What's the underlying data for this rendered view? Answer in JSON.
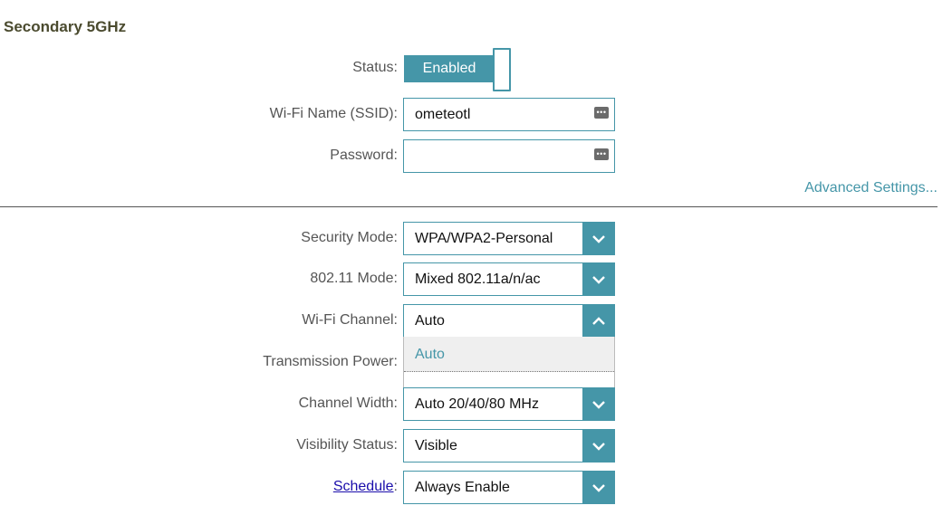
{
  "section_title": "Secondary 5GHz",
  "status": {
    "label": "Status:",
    "toggle_text": "Enabled"
  },
  "ssid": {
    "label": "Wi-Fi Name (SSID):",
    "value": "ometeotl",
    "icon": "keyboard-icon"
  },
  "password": {
    "label": "Password:",
    "value": "",
    "icon": "keyboard-icon"
  },
  "advanced_link": "Advanced Settings...",
  "security_mode": {
    "label": "Security Mode:",
    "value": "WPA/WPA2-Personal"
  },
  "mode_80211": {
    "label": "802.11 Mode:",
    "value": "Mixed 802.11a/n/ac"
  },
  "wifi_channel": {
    "label": "Wi-Fi Channel:",
    "value": "Auto",
    "options": [
      "Auto"
    ]
  },
  "transmission_power": {
    "label": "Transmission Power:"
  },
  "channel_width": {
    "label": "Channel Width:",
    "value": "Auto 20/40/80 MHz"
  },
  "visibility_status": {
    "label": "Visibility Status:",
    "value": "Visible"
  },
  "schedule": {
    "label": "Schedule",
    "colon": ":",
    "value": "Always Enable"
  },
  "colors": {
    "accent": "#4596a8",
    "link": "#1a0dab",
    "title": "#4b4b2f"
  }
}
